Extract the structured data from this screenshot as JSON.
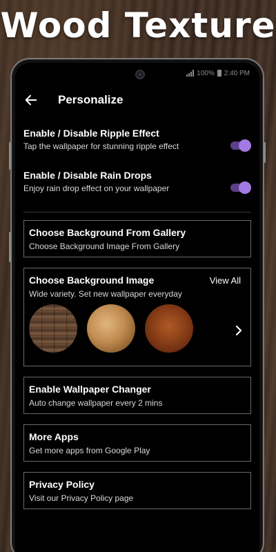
{
  "promo": {
    "title": "Wood Texture"
  },
  "statusbar": {
    "battery": "100%",
    "time": "2:40 PM"
  },
  "appbar": {
    "title": "Personalize",
    "back_icon": "arrow-left-icon"
  },
  "settings": {
    "ripple": {
      "title": "Enable / Disable Ripple Effect",
      "subtitle": "Tap the wallpaper for stunning ripple effect",
      "enabled": true
    },
    "rain": {
      "title": "Enable / Disable Rain Drops",
      "subtitle": "Enjoy rain drop effect on your wallpaper",
      "enabled": true
    }
  },
  "cards": {
    "gallery": {
      "title": "Choose Background From Gallery",
      "subtitle": "Choose Background Image From Gallery"
    },
    "background": {
      "title": "Choose Background Image",
      "subtitle": "Wide variety. Set new wallpaper everyday",
      "view_all": "View All",
      "next_icon": "chevron-right-icon"
    },
    "changer": {
      "title": "Enable Wallpaper Changer",
      "subtitle": "Auto change wallpaper every 2 mins"
    },
    "more_apps": {
      "title": "More Apps",
      "subtitle": "Get more apps from Google Play"
    },
    "privacy": {
      "title": "Privacy Policy",
      "subtitle": "Visit our Privacy Policy page"
    }
  },
  "colors": {
    "accent": "#a37ae3",
    "accent_track": "#5b3f8a",
    "background": "#000000",
    "card_border": "#6a6a6a"
  }
}
